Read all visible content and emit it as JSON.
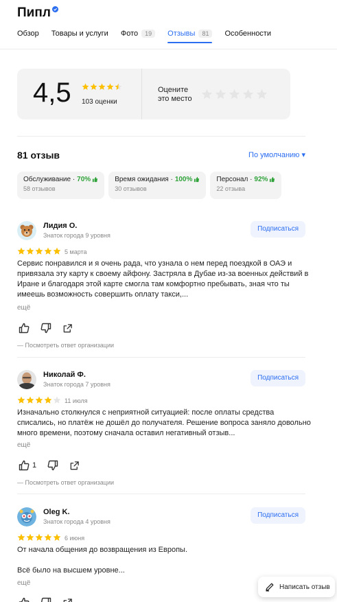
{
  "header": {
    "title": "Пипл",
    "verified_icon": "verified-badge-icon",
    "tabs": [
      {
        "label": "Обзор",
        "count": ""
      },
      {
        "label": "Товары и услуги",
        "count": ""
      },
      {
        "label": "Фото",
        "count": "19"
      },
      {
        "label": "Отзывы",
        "count": "81",
        "active": true
      },
      {
        "label": "Особенности",
        "count": ""
      }
    ]
  },
  "rating": {
    "value": "4,5",
    "stars_filled": 4.5,
    "count_label": "103 оценки",
    "rate_prompt": "Оцените\nэто место",
    "rate_stars": 5
  },
  "reviews_header": {
    "title": "81 отзыв",
    "sort_label": "По умолчанию ▾"
  },
  "categories": [
    {
      "name": "Обслуживание",
      "percent": "70%",
      "count": "58 отзывов"
    },
    {
      "name": "Время ожидания",
      "percent": "100%",
      "count": "30 отзывов"
    },
    {
      "name": "Персонал",
      "percent": "92%",
      "count": "22 отзыва"
    }
  ],
  "reviews": [
    {
      "name": "Лидия О.",
      "level": "Знаток города 9 уровня",
      "stars": 5,
      "date": "5 марта",
      "text": "Сервис понравился и я очень рада, что узнала о нем перед поездкой в ОАЭ и привязала эту карту к своему айфону. Застряла в Дубае из-за военных действий в Иране и благодаря этой карте смогла там комфортно пребывать, зная что ты имеешь возможность совершить оплату такси,...",
      "more": "ещё",
      "likes": "",
      "subscribe": "Подписаться",
      "org_reply": "— Посмотреть ответ организации"
    },
    {
      "name": "Николай Ф.",
      "level": "Знаток города 7 уровня",
      "stars": 4,
      "date": "11 июля",
      "text": "Изначально столкнулся с неприятной ситуацией: после оплаты средства списались, но платёж не дошёл до получателя. Решение вопроса заняло довольно много времени, поэтому сначала оставил негативный отзыв...",
      "more": "ещё",
      "likes": "1",
      "subscribe": "Подписаться",
      "org_reply": "— Посмотреть ответ организации"
    },
    {
      "name": "Oleg K.",
      "level": "Знаток города 4 уровня",
      "stars": 5,
      "date": "6 июня",
      "text": "От начала общения до возвращения из Европы.\n\nВсё было на высшем уровне...",
      "more": "ещё",
      "likes": "",
      "subscribe": "Подписаться",
      "org_reply": ""
    }
  ],
  "write_review": {
    "label": "Написать отзыв",
    "icon": "pencil-icon"
  },
  "colors": {
    "accent": "#2c6ef0",
    "star": "#fcc000",
    "star_empty": "#e5e5e5",
    "positive": "#2fa33a",
    "card_bg": "#f3f3f3"
  }
}
